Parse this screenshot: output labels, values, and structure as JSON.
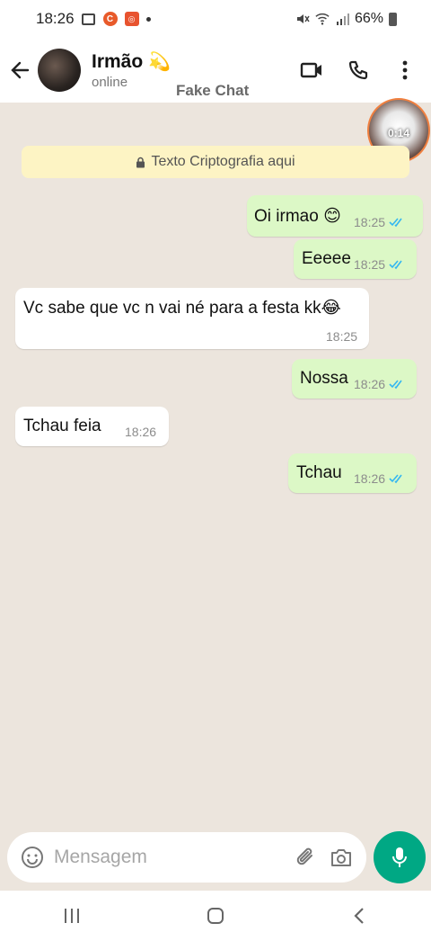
{
  "status_bar": {
    "time": "18:26",
    "battery": "66%"
  },
  "header": {
    "contact_name": "Irmão",
    "contact_emoji": "💫",
    "contact_status": "online",
    "watermark": "Fake Chat"
  },
  "float_video": {
    "timer": "0:14"
  },
  "encryption_notice": "Texto Criptografia aqui",
  "messages": [
    {
      "direction": "out",
      "text": "Oi irmao 😊",
      "time": "18:25",
      "read": true
    },
    {
      "direction": "out",
      "text": "Eeeee",
      "time": "18:25",
      "read": true
    },
    {
      "direction": "in",
      "text": "Vc sabe que vc n vai né para a festa kk😂",
      "time": "18:25"
    },
    {
      "direction": "out",
      "text": "Nossa",
      "time": "18:26",
      "read": true
    },
    {
      "direction": "in",
      "text": "Tchau feia",
      "time": "18:26"
    },
    {
      "direction": "out",
      "text": "Tchau",
      "time": "18:26",
      "read": true
    }
  ],
  "input": {
    "placeholder": "Mensagem"
  },
  "colors": {
    "outgoing_bubble": "#dcf8c6",
    "incoming_bubble": "#ffffff",
    "chat_background": "#ece5dd",
    "accent": "#00a884",
    "read_check": "#34b7f1"
  },
  "icons": {
    "back": "arrow-left-icon",
    "video_call": "video-camera-icon",
    "voice_call": "phone-icon",
    "menu": "more-vertical-icon",
    "emoji": "emoji-icon",
    "attach": "paperclip-icon",
    "camera": "camera-icon",
    "mic": "microphone-icon"
  }
}
